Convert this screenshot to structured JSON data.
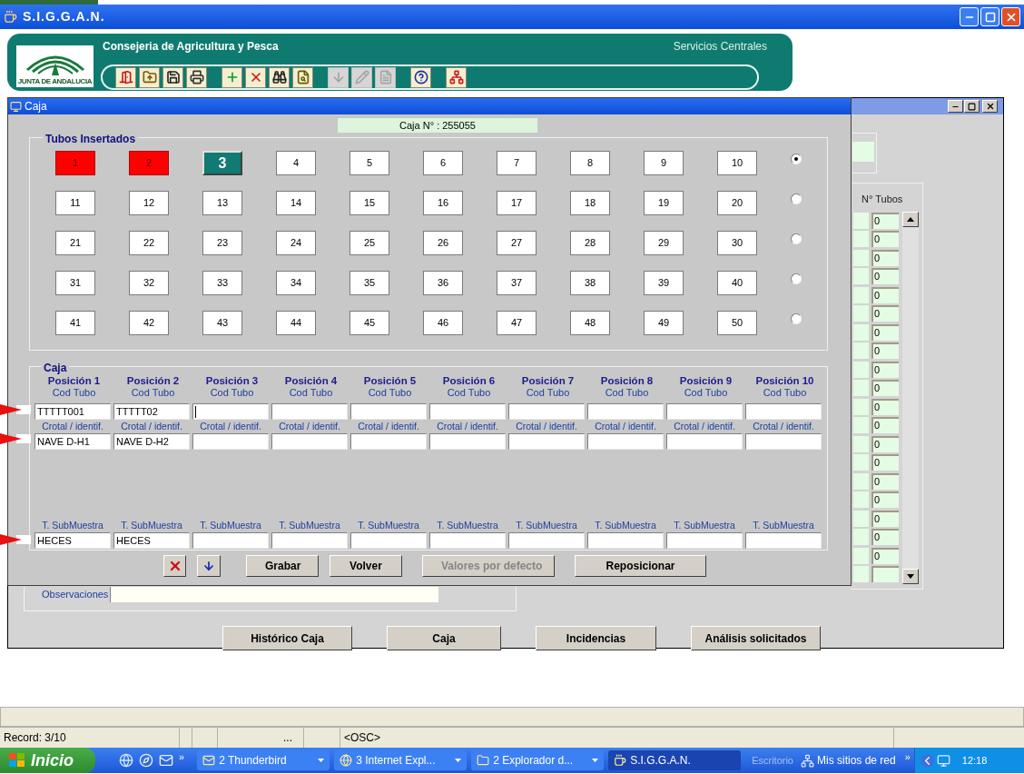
{
  "app_window": {
    "title": "S.I.G.G.A.N."
  },
  "banner": {
    "organization": "Consejeria de Agricultura y Pesca",
    "site": "Servicios Centrales",
    "logo_caption": "JUNTA DE ANDALUCIA",
    "toolbar_groups": [
      {
        "tools": [
          {
            "kind": "exit",
            "disabled": false
          },
          {
            "kind": "open",
            "disabled": false
          },
          {
            "kind": "save",
            "disabled": false
          },
          {
            "kind": "print",
            "disabled": false
          }
        ]
      },
      {
        "tools": [
          {
            "kind": "add",
            "disabled": false
          },
          {
            "kind": "delete",
            "disabled": false
          },
          {
            "kind": "find",
            "disabled": false
          },
          {
            "kind": "preview",
            "disabled": false
          }
        ]
      },
      {
        "tools": [
          {
            "kind": "down",
            "disabled": true
          },
          {
            "kind": "edit",
            "disabled": true
          },
          {
            "kind": "form",
            "disabled": true
          }
        ]
      },
      {
        "tools": [
          {
            "kind": "help",
            "disabled": false
          }
        ]
      },
      {
        "tools": [
          {
            "kind": "tree",
            "disabled": false
          }
        ]
      }
    ]
  },
  "back_window": {
    "tubes_header": "N° Tubos",
    "tube_rows": [
      {
        "count": "0"
      },
      {
        "count": "0"
      },
      {
        "count": "0"
      },
      {
        "count": "0"
      },
      {
        "count": "0"
      },
      {
        "count": "0"
      },
      {
        "count": "0"
      },
      {
        "count": "0"
      },
      {
        "count": "0"
      },
      {
        "count": "0"
      },
      {
        "count": "0"
      },
      {
        "count": "0"
      },
      {
        "count": "0"
      },
      {
        "count": "0"
      },
      {
        "count": "0"
      },
      {
        "count": "0"
      },
      {
        "count": "0"
      },
      {
        "count": "0"
      },
      {
        "count": "0"
      },
      {}
    ],
    "observations_label": "Observaciones",
    "buttons": [
      "Histórico Caja",
      "Caja",
      "Incidencias",
      "Análisis solicitados"
    ]
  },
  "caja_window": {
    "title": "Caja",
    "box_number": "Caja N° : 255055",
    "tubes_group": {
      "title": "Tubos Insertados",
      "rows": [
        {
          "selected": true,
          "tubes": [
            {
              "label": "1",
              "kind": "filled"
            },
            {
              "label": "2",
              "kind": "filled"
            },
            {
              "label": "3",
              "kind": "current"
            },
            {
              "label": "4",
              "kind": "empty"
            },
            {
              "label": "5",
              "kind": "empty"
            },
            {
              "label": "6",
              "kind": "empty"
            },
            {
              "label": "7",
              "kind": "empty"
            },
            {
              "label": "8",
              "kind": "empty"
            },
            {
              "label": "9",
              "kind": "empty"
            },
            {
              "label": "10",
              "kind": "empty"
            }
          ]
        },
        {
          "selected": false,
          "tubes": [
            {
              "label": "11",
              "kind": "empty"
            },
            {
              "label": "12",
              "kind": "empty"
            },
            {
              "label": "13",
              "kind": "empty"
            },
            {
              "label": "14",
              "kind": "empty"
            },
            {
              "label": "15",
              "kind": "empty"
            },
            {
              "label": "16",
              "kind": "empty"
            },
            {
              "label": "17",
              "kind": "empty"
            },
            {
              "label": "18",
              "kind": "empty"
            },
            {
              "label": "19",
              "kind": "empty"
            },
            {
              "label": "20",
              "kind": "empty"
            }
          ]
        },
        {
          "selected": false,
          "tubes": [
            {
              "label": "21",
              "kind": "empty"
            },
            {
              "label": "22",
              "kind": "empty"
            },
            {
              "label": "23",
              "kind": "empty"
            },
            {
              "label": "24",
              "kind": "empty"
            },
            {
              "label": "25",
              "kind": "empty"
            },
            {
              "label": "26",
              "kind": "empty"
            },
            {
              "label": "27",
              "kind": "empty"
            },
            {
              "label": "28",
              "kind": "empty"
            },
            {
              "label": "29",
              "kind": "empty"
            },
            {
              "label": "30",
              "kind": "empty"
            }
          ]
        },
        {
          "selected": false,
          "tubes": [
            {
              "label": "31",
              "kind": "empty"
            },
            {
              "label": "32",
              "kind": "empty"
            },
            {
              "label": "33",
              "kind": "empty"
            },
            {
              "label": "34",
              "kind": "empty"
            },
            {
              "label": "35",
              "kind": "empty"
            },
            {
              "label": "36",
              "kind": "empty"
            },
            {
              "label": "37",
              "kind": "empty"
            },
            {
              "label": "38",
              "kind": "empty"
            },
            {
              "label": "39",
              "kind": "empty"
            },
            {
              "label": "40",
              "kind": "empty"
            }
          ]
        },
        {
          "selected": false,
          "tubes": [
            {
              "label": "41",
              "kind": "empty"
            },
            {
              "label": "42",
              "kind": "empty"
            },
            {
              "label": "43",
              "kind": "empty"
            },
            {
              "label": "44",
              "kind": "empty"
            },
            {
              "label": "45",
              "kind": "empty"
            },
            {
              "label": "46",
              "kind": "empty"
            },
            {
              "label": "47",
              "kind": "empty"
            },
            {
              "label": "48",
              "kind": "empty"
            },
            {
              "label": "49",
              "kind": "empty"
            },
            {
              "label": "50",
              "kind": "empty"
            }
          ]
        }
      ]
    },
    "box_group": {
      "title": "Caja",
      "positions": [
        {
          "header": "Posición 1",
          "code_label": "Cod Tubo",
          "code": "TTTTT001",
          "tag_label": "Crotal / identif.",
          "tag": "NAVE D-H1",
          "sample_label": "T. SubMuestra",
          "sample": "HECES",
          "focused": false
        },
        {
          "header": "Posición 2",
          "code_label": "Cod Tubo",
          "code": "TTTTT02",
          "tag_label": "Crotal / identif.",
          "tag": "NAVE D-H2",
          "sample_label": "T. SubMuestra",
          "sample": "HECES",
          "focused": false
        },
        {
          "header": "Posición 3",
          "code_label": "Cod Tubo",
          "tag_label": "Crotal / identif.",
          "sample_label": "T. SubMuestra",
          "focused": true
        },
        {
          "header": "Posición 4",
          "code_label": "Cod Tubo",
          "tag_label": "Crotal / identif.",
          "sample_label": "T. SubMuestra",
          "focused": false
        },
        {
          "header": "Posición 5",
          "code_label": "Cod Tubo",
          "tag_label": "Crotal / identif.",
          "sample_label": "T. SubMuestra",
          "focused": false
        },
        {
          "header": "Posición 6",
          "code_label": "Cod Tubo",
          "tag_label": "Crotal / identif.",
          "sample_label": "T. SubMuestra",
          "focused": false
        },
        {
          "header": "Posición 7",
          "code_label": "Cod Tubo",
          "tag_label": "Crotal / identif.",
          "sample_label": "T. SubMuestra",
          "focused": false
        },
        {
          "header": "Posición 8",
          "code_label": "Cod Tubo",
          "tag_label": "Crotal / identif.",
          "sample_label": "T. SubMuestra",
          "focused": false
        },
        {
          "header": "Posición 9",
          "code_label": "Cod Tubo",
          "tag_label": "Crotal / identif.",
          "sample_label": "T. SubMuestra",
          "focused": false
        },
        {
          "header": "Posición 10",
          "code_label": "Cod Tubo",
          "tag_label": "Crotal / identif.",
          "sample_label": "T. SubMuestra",
          "focused": false
        }
      ]
    },
    "actions": [
      {
        "kind": "clear",
        "disabled": false
      },
      {
        "kind": "down",
        "disabled": false
      },
      {
        "kind": "text",
        "label": "Grabar",
        "disabled": false
      },
      {
        "kind": "text",
        "label": "Volver",
        "disabled": false
      },
      {
        "kind": "text",
        "label": "Valores por defecto",
        "disabled": true
      },
      {
        "kind": "text",
        "label": "Reposicionar",
        "disabled": false
      }
    ]
  },
  "status_bar": {
    "record": "Record: 3/10",
    "more": "...",
    "mode": "<OSC>"
  },
  "taskbar": {
    "start": "Inicio",
    "quick_overflow": "»",
    "tasks": [
      {
        "kind": "mail",
        "label": "2 Thunderbird",
        "selected": false,
        "grouped": true
      },
      {
        "kind": "browser",
        "label": "3 Internet Expl...",
        "selected": false,
        "grouped": true
      },
      {
        "kind": "folder",
        "label": "2 Explorador d...",
        "selected": false,
        "grouped": true
      },
      {
        "kind": "java",
        "label": "S.I.G.G.A.N.",
        "selected": true,
        "grouped": false
      }
    ],
    "desktop": "Escritorio",
    "network": "Mis sitios de red",
    "tray_overflow": "»",
    "clock": "12:18"
  }
}
